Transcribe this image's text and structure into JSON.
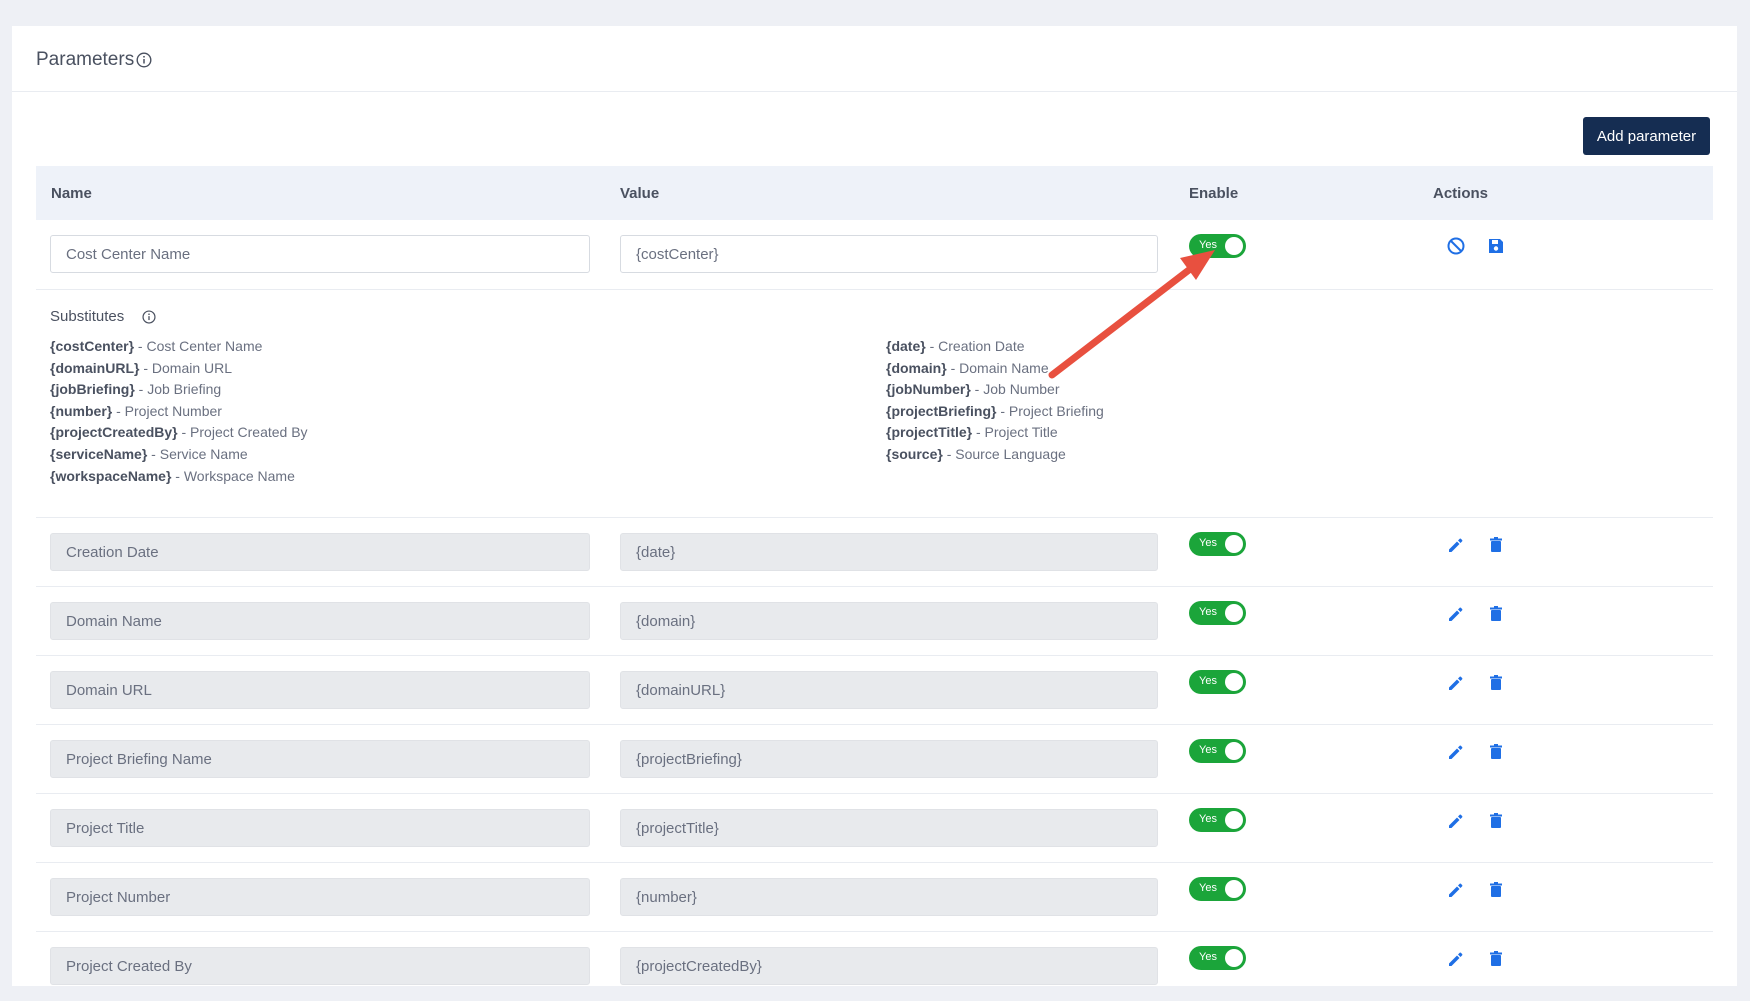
{
  "card": {
    "title": "Parameters",
    "add_button_label": "Add parameter"
  },
  "table": {
    "headers": {
      "name": "Name",
      "value": "Value",
      "enable": "Enable",
      "actions": "Actions"
    }
  },
  "editing_row": {
    "name_value": "Cost Center Name",
    "value_value": "{costCenter}",
    "toggle_label": "Yes",
    "enabled": true
  },
  "substitutes": {
    "title": "Substitutes",
    "left": [
      {
        "key": "{costCenter}",
        "desc": " - Cost Center Name"
      },
      {
        "key": "{domainURL}",
        "desc": " - Domain URL"
      },
      {
        "key": "{jobBriefing}",
        "desc": " - Job Briefing"
      },
      {
        "key": "{number}",
        "desc": " - Project Number"
      },
      {
        "key": "{projectCreatedBy}",
        "desc": " - Project Created By"
      },
      {
        "key": "{serviceName}",
        "desc": " - Service Name"
      },
      {
        "key": "{workspaceName}",
        "desc": " - Workspace Name"
      }
    ],
    "right": [
      {
        "key": "{date}",
        "desc": " - Creation Date"
      },
      {
        "key": "{domain}",
        "desc": " - Domain Name"
      },
      {
        "key": "{jobNumber}",
        "desc": " - Job Number"
      },
      {
        "key": "{projectBriefing}",
        "desc": " - Project Briefing"
      },
      {
        "key": "{projectTitle}",
        "desc": " - Project Title"
      },
      {
        "key": "{source}",
        "desc": " - Source Language"
      }
    ]
  },
  "rows": [
    {
      "name": "Creation Date",
      "value": "{date}",
      "toggle_label": "Yes",
      "enabled": true
    },
    {
      "name": "Domain Name",
      "value": "{domain}",
      "toggle_label": "Yes",
      "enabled": true
    },
    {
      "name": "Domain URL",
      "value": "{domainURL}",
      "toggle_label": "Yes",
      "enabled": true
    },
    {
      "name": "Project Briefing Name",
      "value": "{projectBriefing}",
      "toggle_label": "Yes",
      "enabled": true
    },
    {
      "name": "Project Title",
      "value": "{projectTitle}",
      "toggle_label": "Yes",
      "enabled": true
    },
    {
      "name": "Project Number",
      "value": "{number}",
      "toggle_label": "Yes",
      "enabled": true
    },
    {
      "name": "Project Created By",
      "value": "{projectCreatedBy}",
      "toggle_label": "Yes",
      "enabled": true
    }
  ],
  "icons": {
    "cancel": "cancel-icon",
    "save": "save-icon",
    "edit": "pencil-icon",
    "delete": "trash-icon",
    "info": "info-icon",
    "annotation": "red-arrow"
  },
  "colors": {
    "primary_button": "#152d52",
    "toggle_on": "#1ba53a",
    "action_icon": "#1f6fe5",
    "annotation_arrow": "#e8503f"
  }
}
